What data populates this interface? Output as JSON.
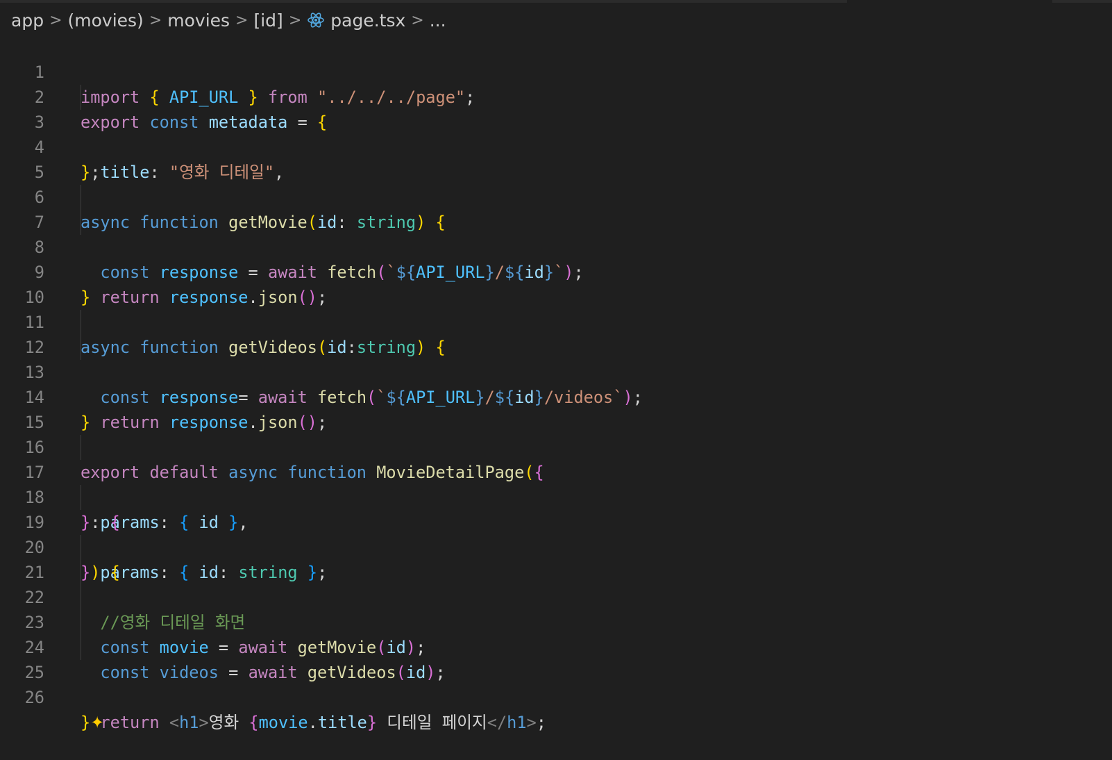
{
  "breadcrumb": {
    "items": [
      "app",
      "(movies)",
      "movies",
      "[id]"
    ],
    "file": "page.tsx",
    "more": "...",
    "separator": ">"
  },
  "line_numbers": [
    "1",
    "2",
    "3",
    "4",
    "5",
    "6",
    "7",
    "8",
    "9",
    "10",
    "11",
    "12",
    "13",
    "14",
    "15",
    "16",
    "17",
    "18",
    "19",
    "20",
    "21",
    "22",
    "23",
    "24",
    "25",
    "26"
  ],
  "code": {
    "l1": [
      "import",
      " ",
      "{",
      " ",
      "API_URL",
      " ",
      "}",
      " ",
      "from",
      " ",
      "\"../../../page\"",
      ";"
    ],
    "l2": [
      "export",
      " ",
      "const",
      " ",
      "metadata",
      " ",
      "=",
      " ",
      "{"
    ],
    "l3": [
      "  ",
      "title",
      ":",
      " ",
      "\"영화 디테일\"",
      ","
    ],
    "l4": [
      "}",
      ";"
    ],
    "l6": [
      "async",
      " ",
      "function",
      " ",
      "getMovie",
      "(",
      "id",
      ":",
      " ",
      "string",
      ")",
      " ",
      "{"
    ],
    "l7": [
      "  ",
      "const",
      " ",
      "response",
      " ",
      "=",
      " ",
      "await",
      " ",
      "fetch",
      "(",
      "`",
      "${",
      "API_URL",
      "}",
      "/",
      "${",
      "id",
      "}",
      "`",
      ")",
      ";"
    ],
    "l8": [
      "  ",
      "return",
      " ",
      "response",
      ".",
      "json",
      "(",
      ")",
      ";"
    ],
    "l9": [
      "}"
    ],
    "l11": [
      "async",
      " ",
      "function",
      " ",
      "getVideos",
      "(",
      "id",
      ":",
      "string",
      ")",
      " ",
      "{"
    ],
    "l12": [
      "  ",
      "const",
      " ",
      "response",
      "=",
      " ",
      "await",
      " ",
      "fetch",
      "(",
      "`",
      "${",
      "API_URL",
      "}",
      "/",
      "${",
      "id",
      "}",
      "/videos`",
      ")",
      ";"
    ],
    "l13": [
      "  ",
      "return",
      " ",
      "response",
      ".",
      "json",
      "(",
      ")",
      ";"
    ],
    "l14": [
      "}"
    ],
    "l16": [
      "export",
      " ",
      "default",
      " ",
      "async",
      " ",
      "function",
      " ",
      "MovieDetailPage",
      "(",
      "{"
    ],
    "l17": [
      "  ",
      "params",
      ":",
      " ",
      "{",
      " ",
      "id",
      " ",
      "}",
      ","
    ],
    "l18": [
      "}",
      ":",
      " ",
      "{"
    ],
    "l19": [
      "  ",
      "params",
      ":",
      " ",
      "{",
      " ",
      "id",
      ":",
      " ",
      "string",
      " ",
      "}",
      ";"
    ],
    "l20": [
      "}",
      ")",
      " ",
      "{"
    ],
    "l21": [
      "  ",
      "//영화 디테일 화면"
    ],
    "l22": [
      "  ",
      "const",
      " ",
      "movie",
      " ",
      "=",
      " ",
      "await",
      " ",
      "getMovie",
      "(",
      "id",
      ")",
      ";"
    ],
    "l23": [
      "  ",
      "const",
      " ",
      "videos",
      " ",
      "=",
      " ",
      "await",
      " ",
      "getVideos",
      "(",
      "id",
      ")",
      ";"
    ],
    "l25": [
      "  ",
      "return",
      " ",
      "<",
      "h1",
      ">",
      "영화 ",
      "{",
      "movie",
      ".",
      "title",
      "}",
      " 디테일 페이지",
      "</",
      "h1",
      ">",
      ";"
    ],
    "l26": [
      "}",
      "✦"
    ]
  }
}
